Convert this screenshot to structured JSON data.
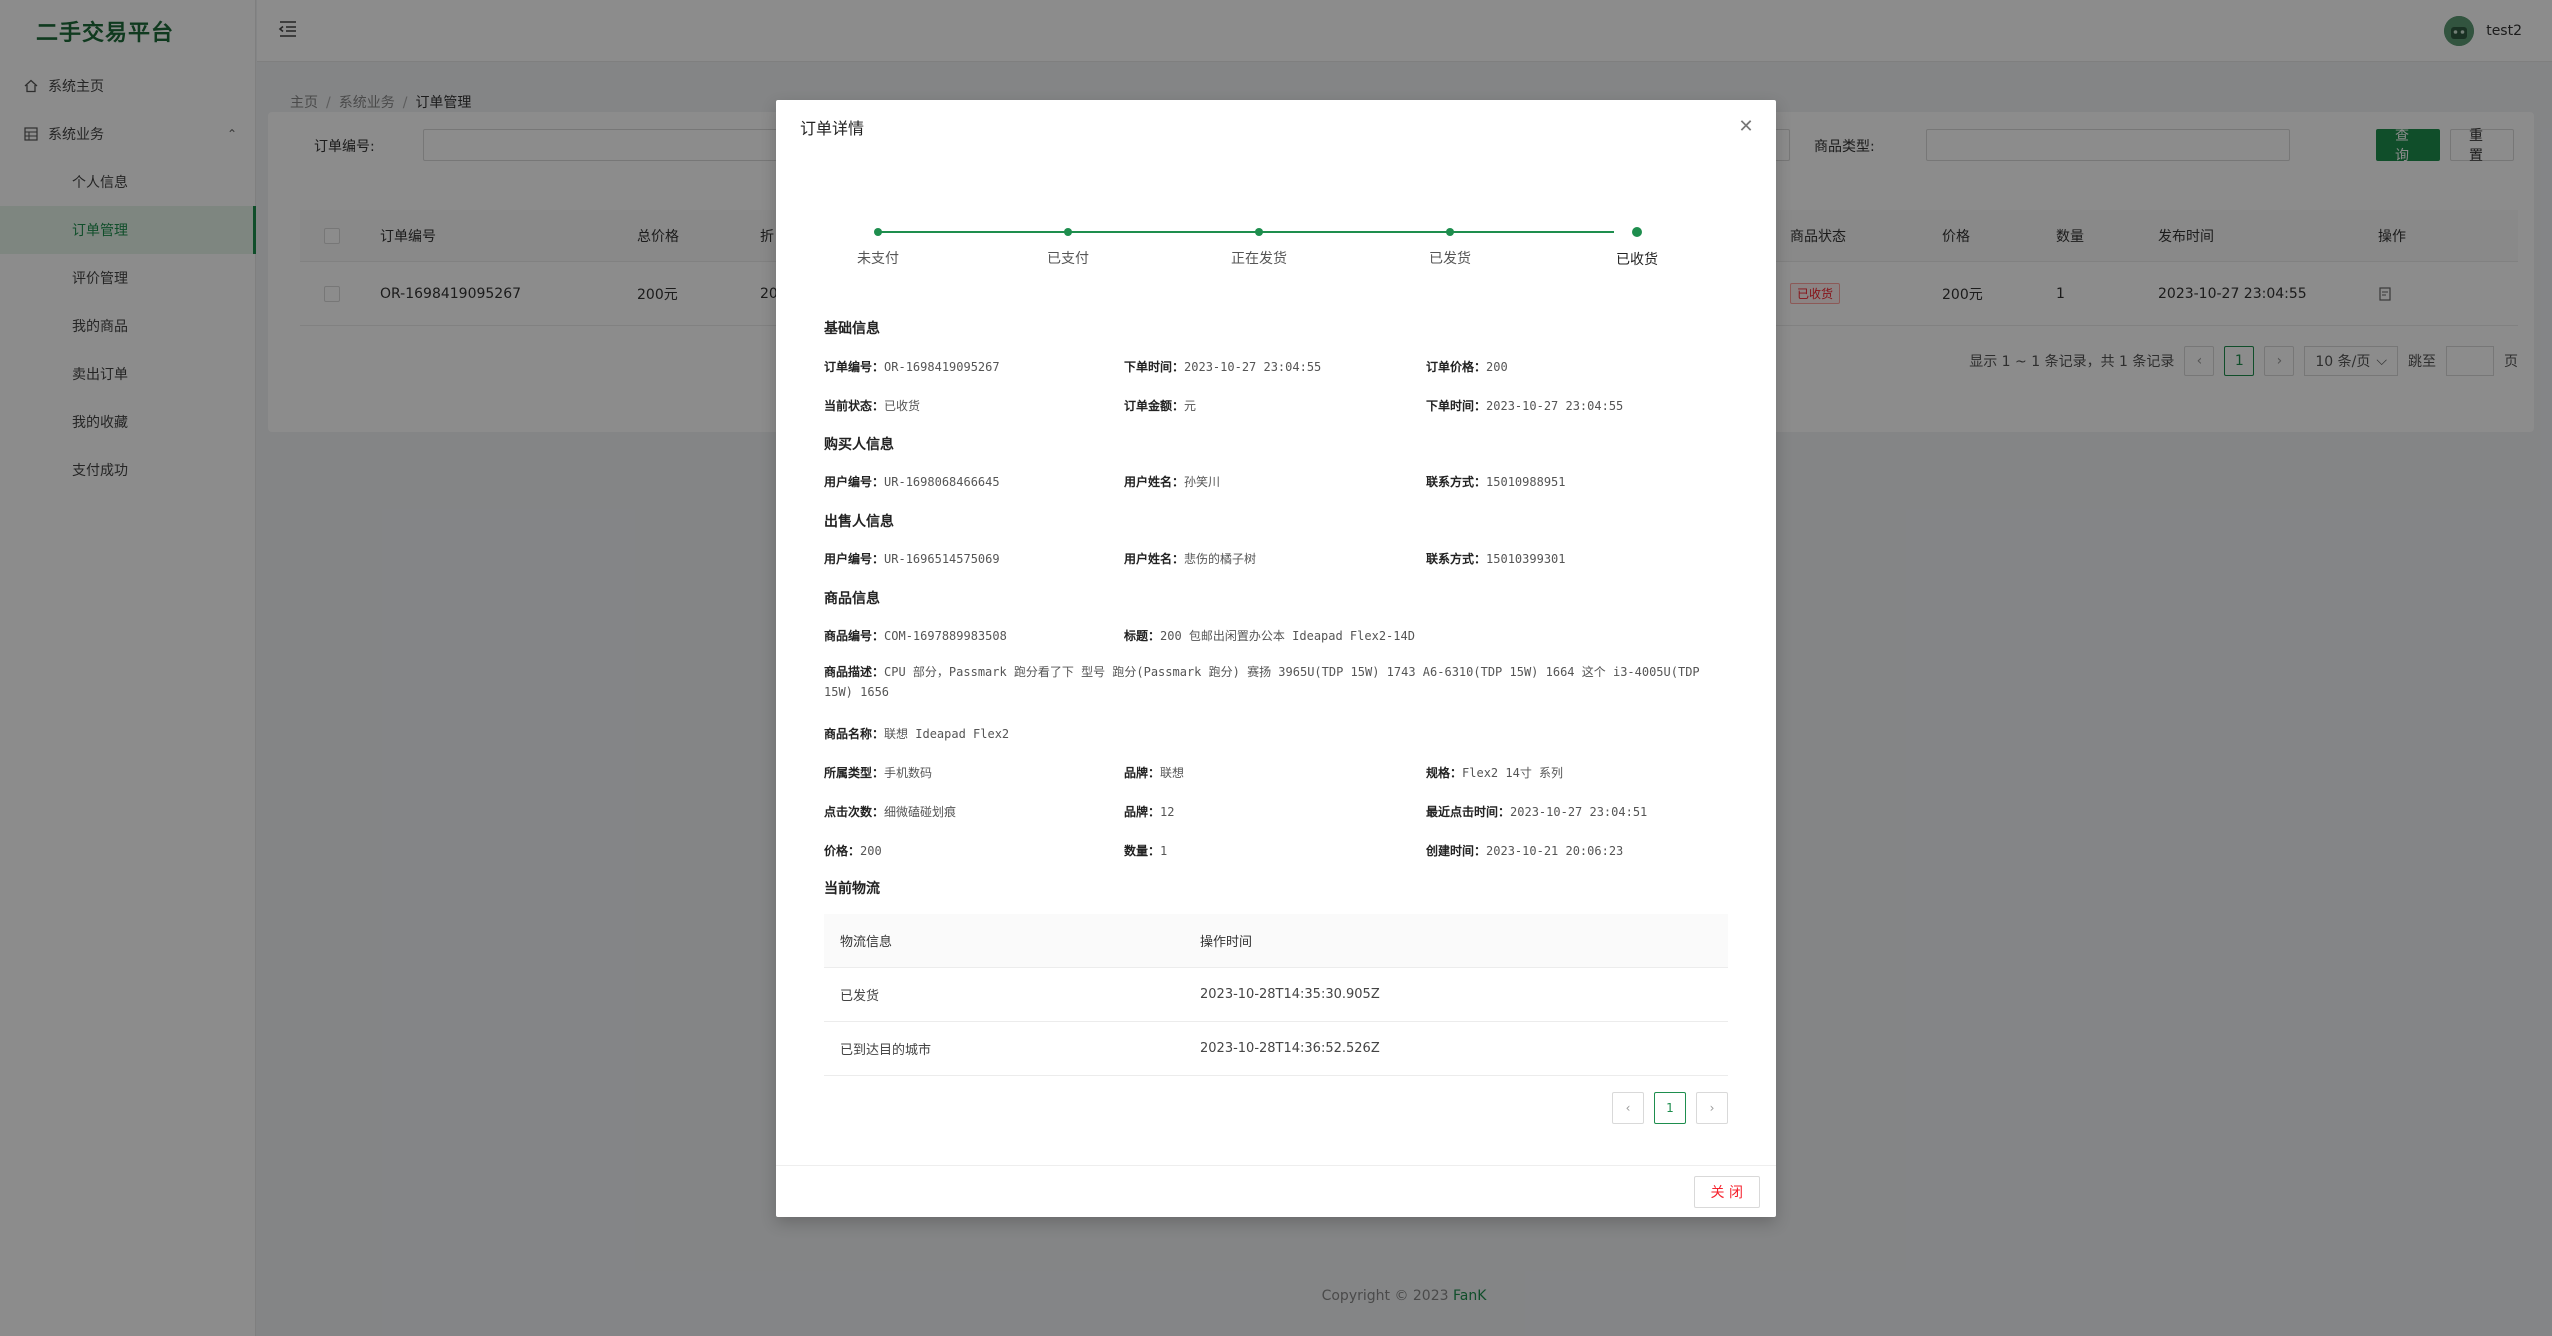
{
  "app": {
    "title": "二手交易平台"
  },
  "sidebar": {
    "home": "系统主页",
    "business": "系统业务",
    "items": [
      "个人信息",
      "订单管理",
      "评价管理",
      "我的商品",
      "卖出订单",
      "我的收藏",
      "支付成功"
    ]
  },
  "header": {
    "username": "test2"
  },
  "breadcrumb": [
    "主页",
    "系统业务",
    "订单管理"
  ],
  "search": {
    "order_no_label": "订单编号:",
    "goods_type_label": "商品类型:",
    "query_btn": "查 询",
    "reset_btn": "重 置"
  },
  "table": {
    "headers": [
      "订单编号",
      "总价格",
      "折",
      "商品状态",
      "价格",
      "数量",
      "发布时间",
      "操作"
    ],
    "row": {
      "order_no": "OR-1698419095267",
      "total": "200元",
      "discount": "20",
      "status": "已收货",
      "price": "200元",
      "qty": "1",
      "time": "2023-10-27 23:04:55"
    }
  },
  "pagination": {
    "summary": "显示 1 ~ 1 条记录，共 1 条记录",
    "current": "1",
    "page_size": "10 条/页",
    "jump": "跳至",
    "page": "页"
  },
  "footer": {
    "copyright": "Copyright © 2023 ",
    "brand": "FanK"
  },
  "modal": {
    "title": "订单详情",
    "steps": [
      "未支付",
      "已支付",
      "正在发货",
      "已发货",
      "已收货"
    ],
    "basic": {
      "title": "基础信息",
      "order_no_k": "订单编号：",
      "order_no_v": "OR-1698419095267",
      "order_time_k": "下单时间：",
      "order_time_v": "2023-10-27 23:04:55",
      "order_price_k": "订单价格：",
      "order_price_v": "200",
      "status_k": "当前状态：",
      "status_v": "已收货",
      "amount_k": "订单金额：",
      "amount_v": "元",
      "order_time2_k": "下单时间：",
      "order_time2_v": "2023-10-27 23:04:55"
    },
    "buyer": {
      "title": "购买人信息",
      "uid_k": "用户编号：",
      "uid_v": "UR-1698068466645",
      "name_k": "用户姓名：",
      "name_v": "孙笑川",
      "phone_k": "联系方式：",
      "phone_v": "15010988951"
    },
    "seller": {
      "title": "出售人信息",
      "uid_k": "用户编号：",
      "uid_v": "UR-1696514575069",
      "name_k": "用户姓名：",
      "name_v": "悲伤的橘子树",
      "phone_k": "联系方式：",
      "phone_v": "15010399301"
    },
    "goods": {
      "title": "商品信息",
      "no_k": "商品编号：",
      "no_v": "COM-1697889983508",
      "title_k": "标题：",
      "title_v": "200 包邮出闲置办公本 Ideapad Flex2-14D",
      "desc_k": "商品描述：",
      "desc_v": "CPU 部分，Passmark 跑分看了下 型号 跑分(Passmark 跑分) 赛扬 3965U(TDP 15W) 1743 A6-6310(TDP 15W) 1664 这个 i3-4005U(TDP 15W) 1656",
      "name_k": "商品名称：",
      "name_v": "联想 Ideapad Flex2",
      "type_k": "所属类型：",
      "type_v": "手机数码",
      "brand_k": "品牌：",
      "brand_v": "联想",
      "spec_k": "规格：",
      "spec_v": "Flex2 14寸 系列",
      "clicks_k": "点击次数：",
      "clicks_v": "细微磕碰划痕",
      "brand2_k": "品牌：",
      "brand2_v": "12",
      "last_click_k": "最近点击时间：",
      "last_click_v": "2023-10-27 23:04:51",
      "price_k": "价格：",
      "price_v": "200",
      "qty_k": "数量：",
      "qty_v": "1",
      "created_k": "创建时间：",
      "created_v": "2023-10-21 20:06:23"
    },
    "logistics": {
      "title": "当前物流",
      "col_info": "物流信息",
      "col_time": "操作时间",
      "rows": [
        {
          "info": "已发货",
          "time": "2023-10-28T14:35:30.905Z"
        },
        {
          "info": "已到达目的城市",
          "time": "2023-10-28T14:36:52.526Z"
        }
      ],
      "page": "1"
    },
    "close_btn": "关 闭"
  }
}
